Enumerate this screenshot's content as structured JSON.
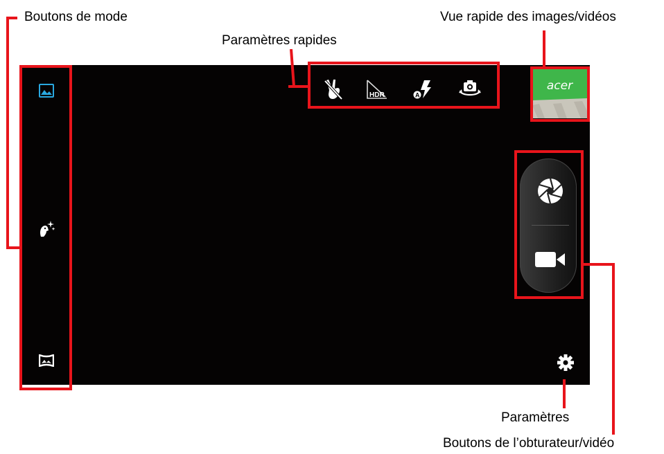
{
  "annotations": {
    "mode_buttons": "Boutons de mode",
    "quick_settings": "Paramètres rapides",
    "quick_view": "Vue rapide des images/vidéos",
    "settings": "Paramètres",
    "shutter_video": "Boutons de l’obturateur/vidéo"
  },
  "camera": {
    "mode_buttons": [
      {
        "icon": "photo-mode-icon",
        "active": true
      },
      {
        "icon": "face-beauty-icon",
        "active": false
      },
      {
        "icon": "panorama-icon",
        "active": false
      }
    ],
    "quick_settings": [
      {
        "icon": "gesture-shot-icon"
      },
      {
        "icon": "hdr-off-icon",
        "text": "HDR"
      },
      {
        "icon": "flash-auto-icon",
        "text": "A"
      },
      {
        "icon": "switch-camera-icon"
      }
    ],
    "gallery_thumbnail": {
      "icon": "gallery-thumbnail",
      "text": "acer"
    },
    "shutter_buttons": [
      {
        "icon": "photo-shutter-icon"
      },
      {
        "icon": "video-record-icon"
      }
    ],
    "settings_icon": "gear-icon"
  },
  "colors": {
    "annotation_red": "#e8141b",
    "active_mode_blue": "#29a8e0",
    "screen_black": "#050303"
  }
}
